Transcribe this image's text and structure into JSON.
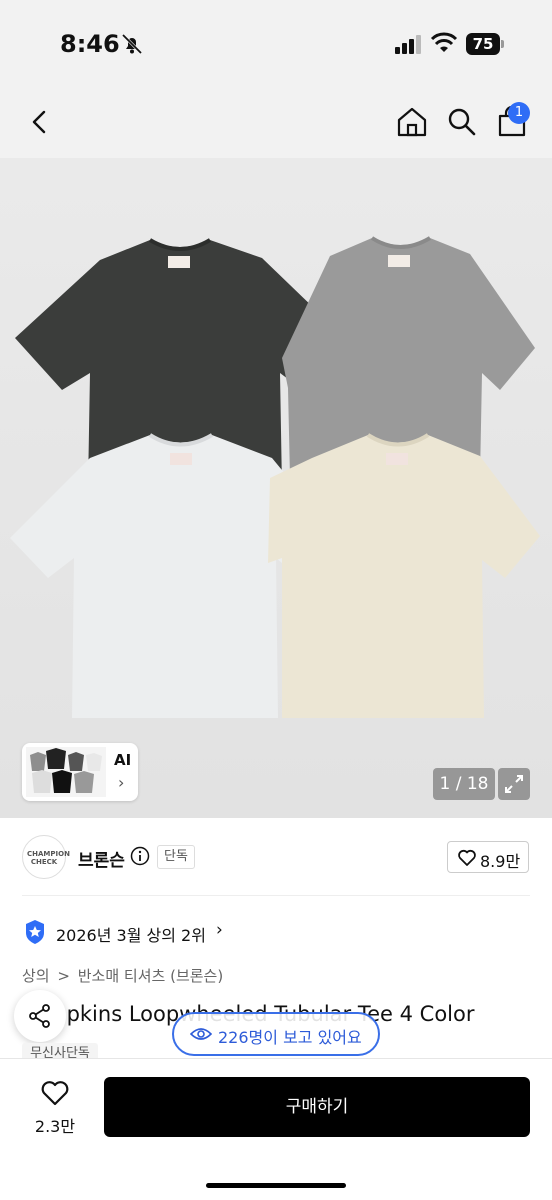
{
  "status_bar": {
    "time": "8:46",
    "battery": "75"
  },
  "nav": {
    "cart_count": "1"
  },
  "gallery": {
    "ai_label": "AI",
    "ai_chevron": "›",
    "counter": "1 / 18",
    "tee_colors": [
      "#3b3d3b",
      "#9a9a9a",
      "#eceeef",
      "#ece6d4"
    ]
  },
  "brand": {
    "logo_text": "CHAMPION CHECK",
    "name": "브론슨",
    "exclusive": "단독",
    "likes": "8.9만"
  },
  "ranking": {
    "text": "2026년 3월 상의 2위",
    "chevron": "›"
  },
  "breadcrumb": {
    "items": [
      "상의",
      ">",
      "반소매 티셔츠 (브론슨)"
    ]
  },
  "product": {
    "title": "Tompkins Loopwheeled Tubular Tee 4 Color",
    "viewers": "226명이 보고 있어요",
    "store_badge": "무신사단독"
  },
  "bottom_bar": {
    "wish_count": "2.3만",
    "buy_label": "구매하기"
  },
  "colors": {
    "accent_blue": "#2f6df6",
    "viewer_blue": "#3a6fe8",
    "buy_bg": "#000000"
  }
}
